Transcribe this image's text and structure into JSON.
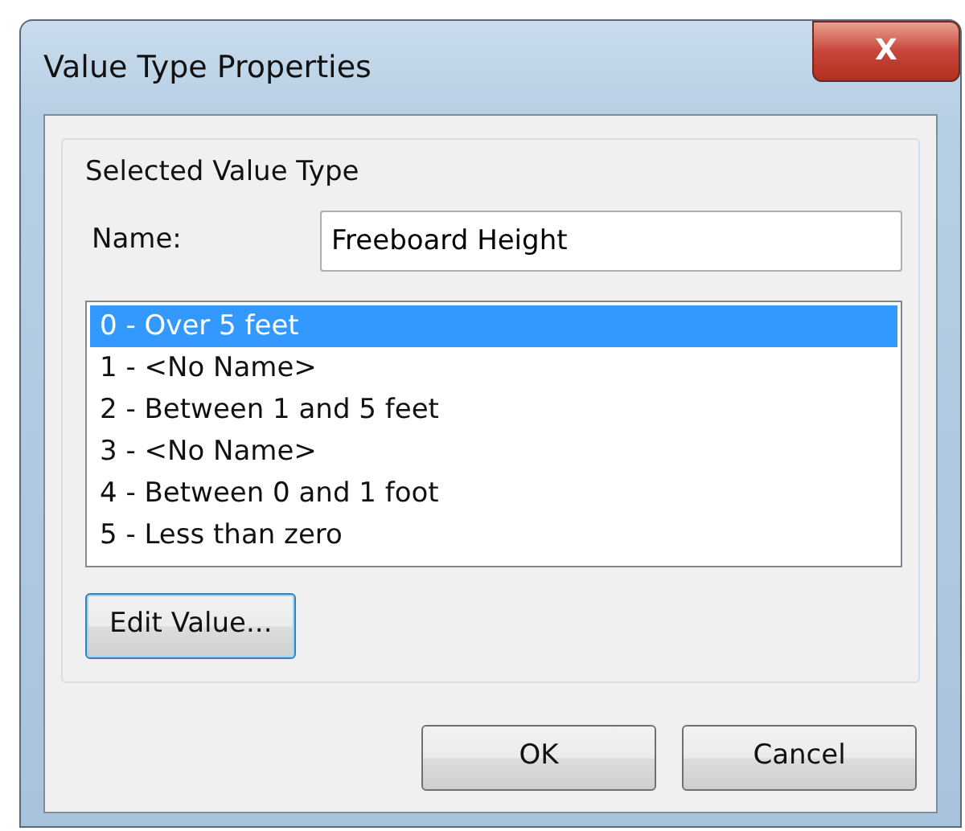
{
  "window": {
    "title": "Value Type Properties",
    "close": "X"
  },
  "group": {
    "title": "Selected Value Type"
  },
  "name_field": {
    "label": "Name:",
    "value": "Freeboard Height"
  },
  "values": [
    {
      "label": "0 - Over 5 feet",
      "selected": true
    },
    {
      "label": "1 - <No Name>",
      "selected": false
    },
    {
      "label": "2 - Between 1 and 5 feet",
      "selected": false
    },
    {
      "label": "3 - <No Name>",
      "selected": false
    },
    {
      "label": "4 - Between 0 and 1 foot",
      "selected": false
    },
    {
      "label": "5 - Less than zero",
      "selected": false
    }
  ],
  "edit_button": {
    "label": "Edit Value...",
    "focused": true
  },
  "buttons": [
    "OK",
    "Cancel"
  ]
}
